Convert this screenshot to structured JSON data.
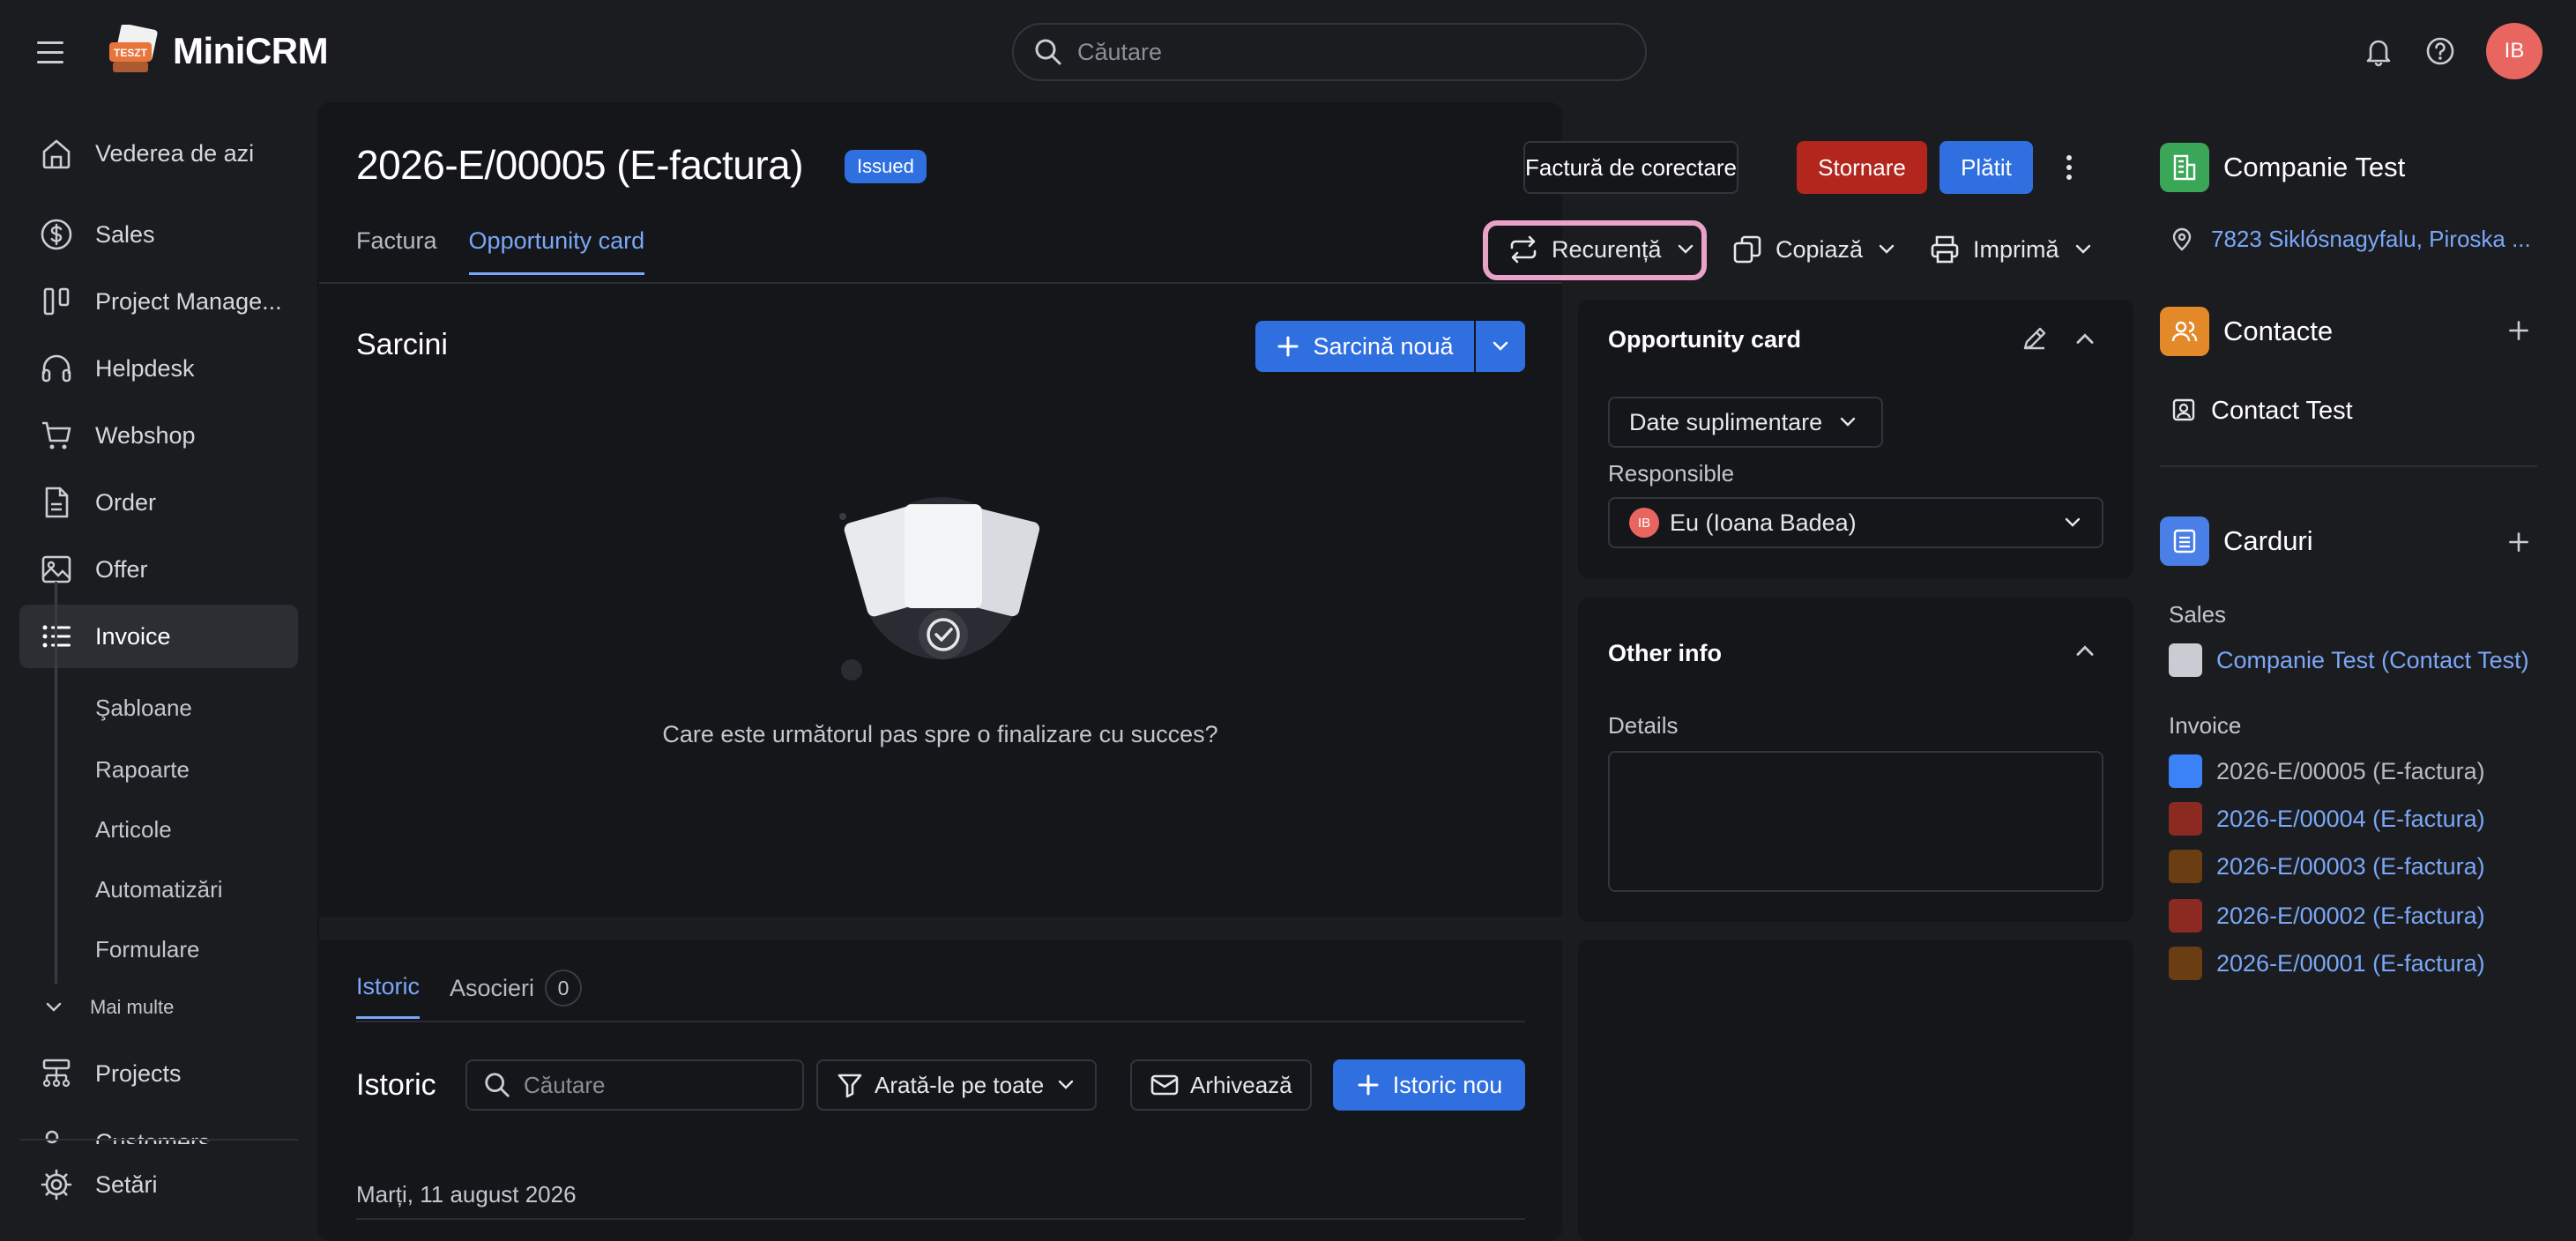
{
  "app": {
    "name": "MiniCRM",
    "logo_badge": "TESZT"
  },
  "search": {
    "placeholder": "Căutare"
  },
  "user": {
    "initials": "IB"
  },
  "sidebar": {
    "items": [
      {
        "label": "Vederea de azi",
        "icon": "home-icon"
      },
      {
        "label": "Sales",
        "icon": "dollar-icon"
      },
      {
        "label": "Project Manage...",
        "icon": "kanban-icon"
      },
      {
        "label": "Helpdesk",
        "icon": "headset-icon"
      },
      {
        "label": "Webshop",
        "icon": "cart-icon"
      },
      {
        "label": "Order",
        "icon": "document-icon"
      },
      {
        "label": "Offer",
        "icon": "image-icon"
      },
      {
        "label": "Invoice",
        "icon": "list-icon",
        "active": true
      }
    ],
    "sub_items": [
      "Şabloane",
      "Rapoarte",
      "Articole",
      "Automatizări",
      "Formulare"
    ],
    "more_label": "Mai multe",
    "bottom_items": [
      {
        "label": "Projects",
        "icon": "hierarchy-icon"
      },
      {
        "label": "Customers",
        "icon": "users-icon"
      }
    ],
    "settings_label": "Setări"
  },
  "invoice": {
    "title": "2026-E/00005 (E-factura)",
    "status": "Issued",
    "actions": {
      "corrective": "Factură de corectare",
      "storno": "Stornare",
      "paid": "Plătit"
    },
    "tabs": [
      "Factura",
      "Opportunity card"
    ],
    "active_tab": "Opportunity card",
    "toolbar": {
      "recurrence": "Recurență",
      "copy": "Copiază",
      "print": "Imprimă"
    }
  },
  "tasks": {
    "title": "Sarcini",
    "new_task": "Sarcină nouă",
    "empty_text": "Care este următorul pas spre o finalizare cu succes?"
  },
  "history": {
    "tabs": [
      "Istoric",
      "Asocieri"
    ],
    "associations_count": "0",
    "title": "Istoric",
    "search_placeholder": "Căutare",
    "filter_label": "Arată-le pe toate",
    "archive_label": "Arhivează",
    "new_label": "Istoric nou",
    "date": "Marți, 11 august 2026"
  },
  "opportunity_card": {
    "title": "Opportunity card",
    "extra_data": "Date suplimentare",
    "responsible_label": "Responsible",
    "responsible_value": "Eu (Ioana Badea)",
    "responsible_initials": "IB"
  },
  "other_info": {
    "title": "Other info",
    "details_label": "Details"
  },
  "right": {
    "company": {
      "name": "Companie Test",
      "address": "7823 Siklósnagyfalu, Piroska ..."
    },
    "contacts": {
      "title": "Contacte",
      "contact": "Contact Test"
    },
    "cards": {
      "title": "Carduri",
      "sales_label": "Sales",
      "sales_items": [
        {
          "label": "Companie Test (Contact Test)",
          "color": "#c9ccd2"
        }
      ],
      "invoice_label": "Invoice",
      "invoice_items": [
        {
          "label": "2026-E/00005 (E-factura)",
          "color": "#3b82f6",
          "current": true
        },
        {
          "label": "2026-E/00004 (E-factura)",
          "color": "#8b2a20"
        },
        {
          "label": "2026-E/00003 (E-factura)",
          "color": "#6b3d12"
        },
        {
          "label": "2026-E/00002 (E-factura)",
          "color": "#8b2a20"
        },
        {
          "label": "2026-E/00001 (E-factura)",
          "color": "#6b3d12"
        }
      ]
    }
  },
  "colors": {
    "primary": "#2f6fe0",
    "danger": "#b3261e",
    "link": "#7aa7f7",
    "highlight": "#e9a3c9"
  }
}
